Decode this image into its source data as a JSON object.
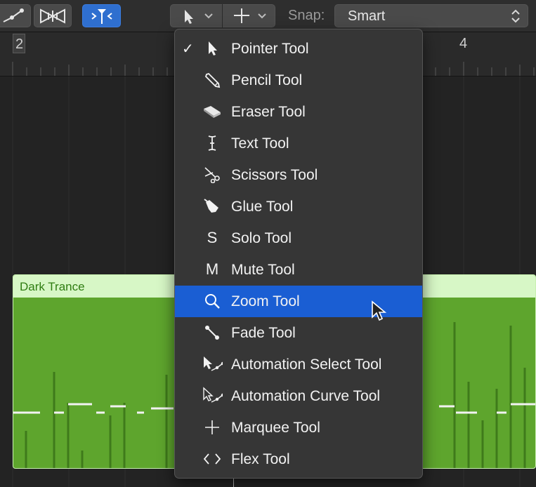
{
  "toolbar": {
    "left_tool_icon": "automation-curve-icon",
    "flex_icon": "flex-waveform-icon",
    "catch_icon": "catch-playhead-icon",
    "pointer_menu_icon": "pointer-icon",
    "secondary_menu_icon": "crosshair-icon",
    "snap_label": "Snap:",
    "snap_value": "Smart"
  },
  "ruler": {
    "bar_numbers": [
      "2",
      "4"
    ]
  },
  "region": {
    "name": "Dark Trance"
  },
  "tool_menu": {
    "items": [
      {
        "label": "Pointer Tool",
        "icon": "pointer-icon",
        "checked": true
      },
      {
        "label": "Pencil Tool",
        "icon": "pencil-icon"
      },
      {
        "label": "Eraser Tool",
        "icon": "eraser-icon"
      },
      {
        "label": "Text Tool",
        "icon": "text-cursor-icon"
      },
      {
        "label": "Scissors Tool",
        "icon": "scissors-icon"
      },
      {
        "label": "Glue Tool",
        "icon": "glue-icon"
      },
      {
        "label": "Solo Tool",
        "icon": "S"
      },
      {
        "label": "Mute Tool",
        "icon": "M"
      },
      {
        "label": "Zoom Tool",
        "icon": "magnifier-icon",
        "highlighted": true
      },
      {
        "label": "Fade Tool",
        "icon": "fade-icon"
      },
      {
        "label": "Automation Select Tool",
        "icon": "automation-select-icon"
      },
      {
        "label": "Automation Curve Tool",
        "icon": "automation-curve-icon"
      },
      {
        "label": "Marquee Tool",
        "icon": "crosshair-icon"
      },
      {
        "label": "Flex Tool",
        "icon": "flex-icon"
      }
    ]
  },
  "colors": {
    "highlight": "#1a5ed3",
    "region_fill": "#5ea52d",
    "region_header": "#d7f7c6",
    "region_text": "#2f7d12"
  }
}
